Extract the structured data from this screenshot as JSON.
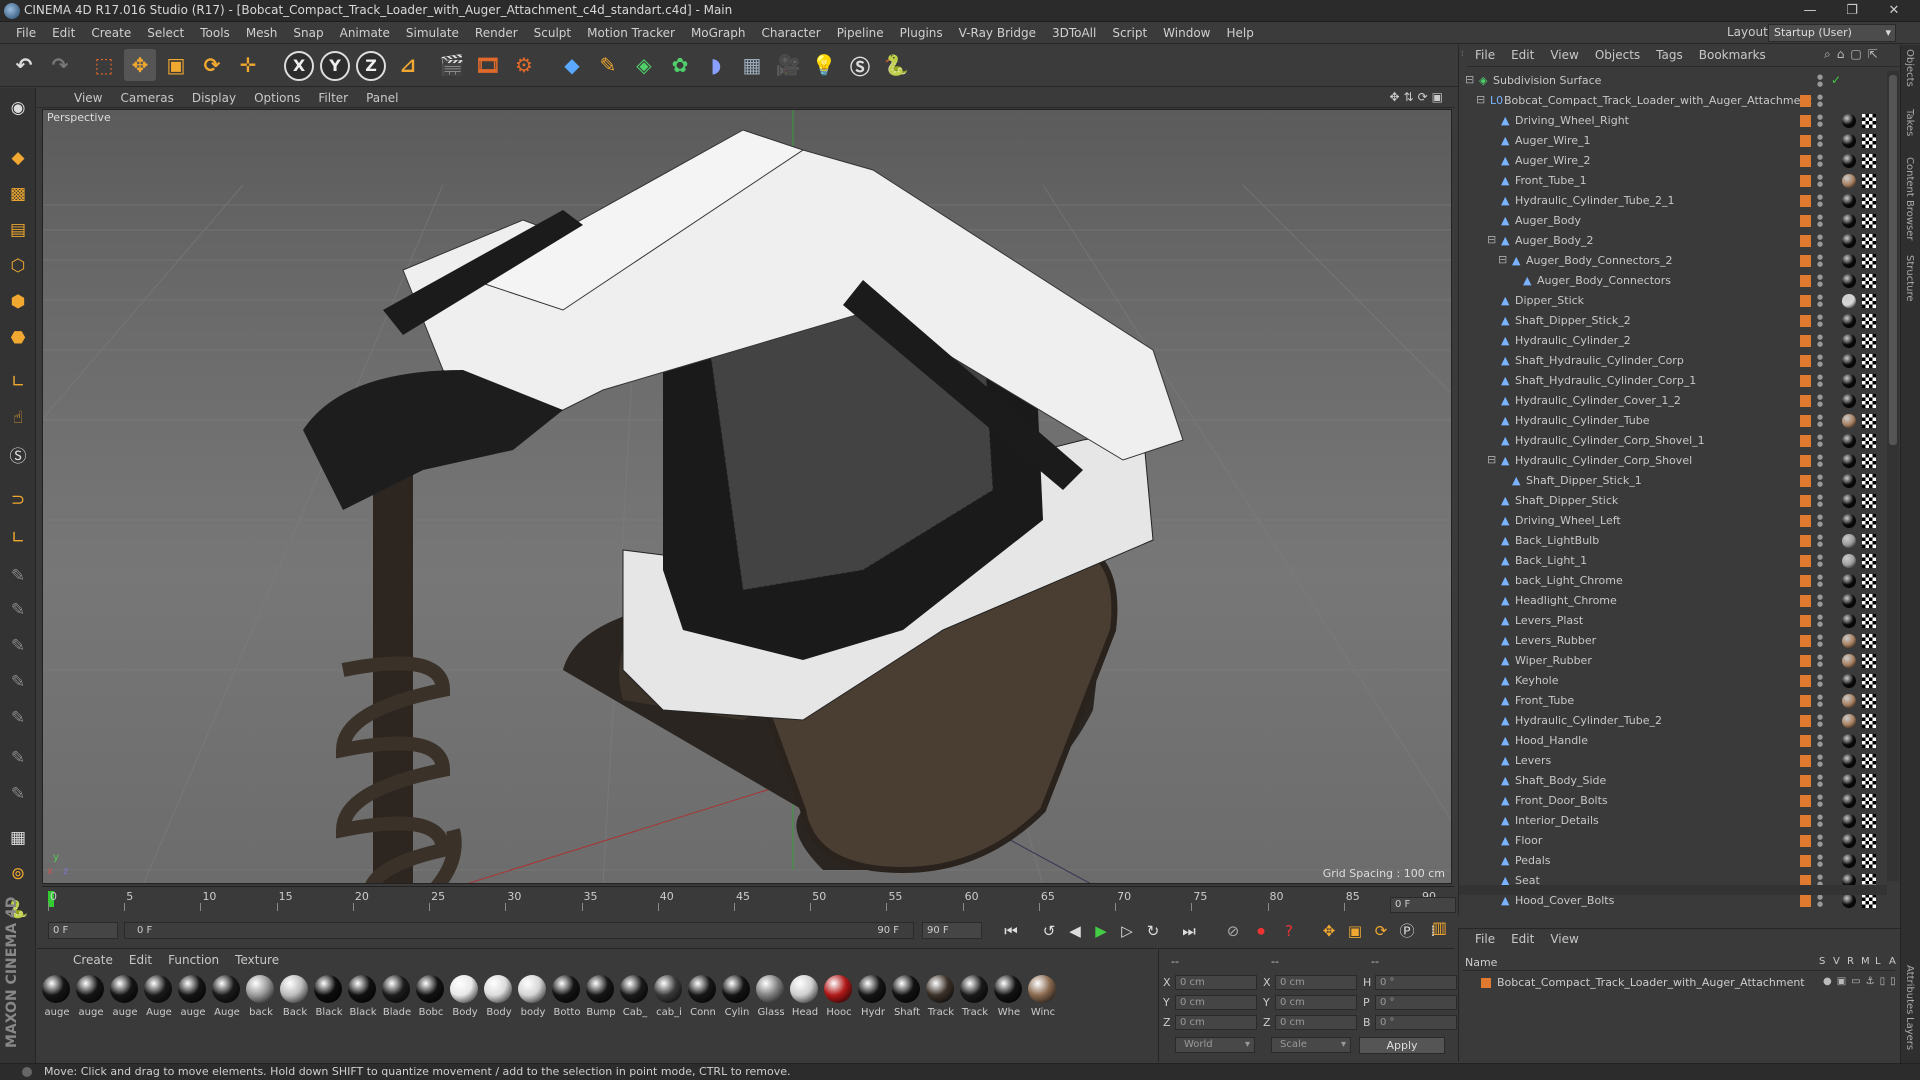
{
  "window": {
    "title": "CINEMA 4D R17.016 Studio (R17) - [Bobcat_Compact_Track_Loader_with_Auger_Attachment_c4d_standart.c4d] - Main",
    "controls": [
      "—",
      "❐",
      "✕"
    ]
  },
  "menu": [
    "File",
    "Edit",
    "Create",
    "Select",
    "Tools",
    "Mesh",
    "Snap",
    "Animate",
    "Simulate",
    "Render",
    "Sculpt",
    "Motion Tracker",
    "MoGraph",
    "Character",
    "Pipeline",
    "Plugins",
    "V-Ray Bridge",
    "3DToAll",
    "Script",
    "Window",
    "Help"
  ],
  "layout": {
    "label": "Layout:",
    "value": "Startup (User)"
  },
  "toolbar": {
    "axis": [
      "X",
      "Y",
      "Z"
    ]
  },
  "viewport": {
    "menu": [
      "View",
      "Cameras",
      "Display",
      "Options",
      "Filter",
      "Panel"
    ],
    "label": "Perspective",
    "grid_spacing": "Grid Spacing : 100 cm"
  },
  "timeline": {
    "ticks": [
      "0",
      "5",
      "10",
      "15",
      "20",
      "25",
      "30",
      "35",
      "40",
      "45",
      "50",
      "55",
      "60",
      "65",
      "70",
      "75",
      "80",
      "85",
      "90"
    ],
    "end_field": "0 F",
    "start_field": "0 F",
    "range_start": "0 F",
    "range_end": "90 F",
    "max_field": "90 F"
  },
  "materials": {
    "menu": [
      "Create",
      "Edit",
      "Function",
      "Texture"
    ],
    "items": [
      {
        "name": "auge",
        "color": "#151515"
      },
      {
        "name": "auge",
        "color": "#151515"
      },
      {
        "name": "auge",
        "color": "#151515"
      },
      {
        "name": "Auge",
        "color": "#1a1a1a"
      },
      {
        "name": "auge",
        "color": "#151515"
      },
      {
        "name": "Auge",
        "color": "#1a1a1a"
      },
      {
        "name": "back",
        "color": "#9a9a9a"
      },
      {
        "name": "Back",
        "color": "#bcbcbc"
      },
      {
        "name": "Black",
        "color": "#0d0d0d"
      },
      {
        "name": "Black",
        "color": "#111"
      },
      {
        "name": "Blade",
        "color": "#1c1c1c"
      },
      {
        "name": "Bobc",
        "color": "#121212"
      },
      {
        "name": "Body",
        "color": "#e8e8e8"
      },
      {
        "name": "Body",
        "color": "#dcdcdc"
      },
      {
        "name": "body",
        "color": "#d5d5d5"
      },
      {
        "name": "Botto",
        "color": "#141414"
      },
      {
        "name": "Bump",
        "color": "#161616"
      },
      {
        "name": "Cab_",
        "color": "#1a1a1a"
      },
      {
        "name": "cab_i",
        "color": "#3a3a3a"
      },
      {
        "name": "Conn",
        "color": "#171717"
      },
      {
        "name": "Cylin",
        "color": "#131313"
      },
      {
        "name": "Glass",
        "color": "#808080"
      },
      {
        "name": "Head",
        "color": "#cfcfcf"
      },
      {
        "name": "Hooc",
        "color": "#b01818"
      },
      {
        "name": "Hydr",
        "color": "#151515"
      },
      {
        "name": "Shaft",
        "color": "#121212"
      },
      {
        "name": "Track",
        "color": "#3b3129"
      },
      {
        "name": "Track",
        "color": "#1a1a1a"
      },
      {
        "name": "Whe",
        "color": "#121212"
      },
      {
        "name": "Winc",
        "color": "#8a6a50"
      }
    ]
  },
  "coords": {
    "rows": [
      {
        "a": "X",
        "av": "0 cm",
        "b": "X",
        "bv": "0 cm",
        "c": "H",
        "cv": "0 °"
      },
      {
        "a": "Y",
        "av": "0 cm",
        "b": "Y",
        "bv": "0 cm",
        "c": "P",
        "cv": "0 °"
      },
      {
        "a": "Z",
        "av": "0 cm",
        "b": "Z",
        "bv": "0 cm",
        "c": "B",
        "cv": "0 °"
      }
    ],
    "header_a": "--",
    "header_b": "--",
    "header_c": "--",
    "world": "World",
    "scale": "Scale",
    "apply": "Apply"
  },
  "status": "Move: Click and drag to move elements. Hold down SHIFT to quantize movement / add to the selection in point mode, CTRL to remove.",
  "objects": {
    "menu": [
      "File",
      "Edit",
      "View",
      "Objects",
      "Tags",
      "Bookmarks"
    ],
    "rows": [
      {
        "name": "Subdivision Surface",
        "indent": 0,
        "expander": "⊟",
        "icon": "◈",
        "icon_color": "#4fd06a",
        "tag": "none"
      },
      {
        "name": "Bobcat_Compact_Track_Loader_with_Auger_Attachment",
        "indent": 1,
        "expander": "⊟",
        "icon": "L0",
        "icon_color": "#7ab2ff",
        "tag": "none"
      },
      {
        "name": "Driving_Wheel_Right",
        "indent": 2,
        "expander": "",
        "icon": "▲",
        "icon_color": "#7ab2ff",
        "tag": "#0a0a0a"
      },
      {
        "name": "Auger_Wire_1",
        "indent": 2,
        "expander": "",
        "icon": "▲",
        "icon_color": "#7ab2ff",
        "tag": "#0a0a0a"
      },
      {
        "name": "Auger_Wire_2",
        "indent": 2,
        "expander": "",
        "icon": "▲",
        "icon_color": "#7ab2ff",
        "tag": "#0a0a0a"
      },
      {
        "name": "Front_Tube_1",
        "indent": 2,
        "expander": "",
        "icon": "▲",
        "icon_color": "#7ab2ff",
        "tag": "#a88060"
      },
      {
        "name": "Hydraulic_Cylinder_Tube_2_1",
        "indent": 2,
        "expander": "",
        "icon": "▲",
        "icon_color": "#7ab2ff",
        "tag": "#0a0a0a"
      },
      {
        "name": "Auger_Body",
        "indent": 2,
        "expander": "",
        "icon": "▲",
        "icon_color": "#7ab2ff",
        "tag": "#0a0a0a"
      },
      {
        "name": "Auger_Body_2",
        "indent": 2,
        "expander": "⊟",
        "icon": "▲",
        "icon_color": "#7ab2ff",
        "tag": "#0a0a0a"
      },
      {
        "name": "Auger_Body_Connectors_2",
        "indent": 3,
        "expander": "⊟",
        "icon": "▲",
        "icon_color": "#7ab2ff",
        "tag": "#0a0a0a"
      },
      {
        "name": "Auger_Body_Connectors",
        "indent": 4,
        "expander": "",
        "icon": "▲",
        "icon_color": "#7ab2ff",
        "tag": "#0a0a0a"
      },
      {
        "name": "Dipper_Stick",
        "indent": 2,
        "expander": "",
        "icon": "▲",
        "icon_color": "#7ab2ff",
        "tag": "#d8d8d8"
      },
      {
        "name": "Shaft_Dipper_Stick_2",
        "indent": 2,
        "expander": "",
        "icon": "▲",
        "icon_color": "#7ab2ff",
        "tag": "#0a0a0a"
      },
      {
        "name": "Hydraulic_Cylinder_2",
        "indent": 2,
        "expander": "",
        "icon": "▲",
        "icon_color": "#7ab2ff",
        "tag": "#0a0a0a"
      },
      {
        "name": "Shaft_Hydraulic_Cylinder_Corp",
        "indent": 2,
        "expander": "",
        "icon": "▲",
        "icon_color": "#7ab2ff",
        "tag": "#0a0a0a"
      },
      {
        "name": "Shaft_Hydraulic_Cylinder_Corp_1",
        "indent": 2,
        "expander": "",
        "icon": "▲",
        "icon_color": "#7ab2ff",
        "tag": "#0a0a0a"
      },
      {
        "name": "Hydraulic_Cylinder_Cover_1_2",
        "indent": 2,
        "expander": "",
        "icon": "▲",
        "icon_color": "#7ab2ff",
        "tag": "#0a0a0a"
      },
      {
        "name": "Hydraulic_Cylinder_Tube",
        "indent": 2,
        "expander": "",
        "icon": "▲",
        "icon_color": "#7ab2ff",
        "tag": "#a88060"
      },
      {
        "name": "Hydraulic_Cylinder_Corp_Shovel_1",
        "indent": 2,
        "expander": "",
        "icon": "▲",
        "icon_color": "#7ab2ff",
        "tag": "#0a0a0a"
      },
      {
        "name": "Hydraulic_Cylinder_Corp_Shovel",
        "indent": 2,
        "expander": "⊟",
        "icon": "▲",
        "icon_color": "#7ab2ff",
        "tag": "#0a0a0a"
      },
      {
        "name": "Shaft_Dipper_Stick_1",
        "indent": 3,
        "expander": "",
        "icon": "▲",
        "icon_color": "#7ab2ff",
        "tag": "#0a0a0a"
      },
      {
        "name": "Shaft_Dipper_Stick",
        "indent": 2,
        "expander": "",
        "icon": "▲",
        "icon_color": "#7ab2ff",
        "tag": "#0a0a0a"
      },
      {
        "name": "Driving_Wheel_Left",
        "indent": 2,
        "expander": "",
        "icon": "▲",
        "icon_color": "#7ab2ff",
        "tag": "#0a0a0a"
      },
      {
        "name": "Back_LightBulb",
        "indent": 2,
        "expander": "",
        "icon": "▲",
        "icon_color": "#7ab2ff",
        "tag": "#9a9a9a"
      },
      {
        "name": "Back_Light_1",
        "indent": 2,
        "expander": "",
        "icon": "▲",
        "icon_color": "#7ab2ff",
        "tag": "#a0a0a0"
      },
      {
        "name": "back_Light_Chrome",
        "indent": 2,
        "expander": "",
        "icon": "▲",
        "icon_color": "#7ab2ff",
        "tag": "#0a0a0a"
      },
      {
        "name": "Headlight_Chrome",
        "indent": 2,
        "expander": "",
        "icon": "▲",
        "icon_color": "#7ab2ff",
        "tag": "#0a0a0a"
      },
      {
        "name": "Levers_Plast",
        "indent": 2,
        "expander": "",
        "icon": "▲",
        "icon_color": "#7ab2ff",
        "tag": "#0a0a0a"
      },
      {
        "name": "Levers_Rubber",
        "indent": 2,
        "expander": "",
        "icon": "▲",
        "icon_color": "#7ab2ff",
        "tag": "#a88060"
      },
      {
        "name": "Wiper_Rubber",
        "indent": 2,
        "expander": "",
        "icon": "▲",
        "icon_color": "#7ab2ff",
        "tag": "#a88060"
      },
      {
        "name": "Keyhole",
        "indent": 2,
        "expander": "",
        "icon": "▲",
        "icon_color": "#7ab2ff",
        "tag": "#0a0a0a"
      },
      {
        "name": "Front_Tube",
        "indent": 2,
        "expander": "",
        "icon": "▲",
        "icon_color": "#7ab2ff",
        "tag": "#a88060"
      },
      {
        "name": "Hydraulic_Cylinder_Tube_2",
        "indent": 2,
        "expander": "",
        "icon": "▲",
        "icon_color": "#7ab2ff",
        "tag": "#a88060"
      },
      {
        "name": "Hood_Handle",
        "indent": 2,
        "expander": "",
        "icon": "▲",
        "icon_color": "#7ab2ff",
        "tag": "#0a0a0a"
      },
      {
        "name": "Levers",
        "indent": 2,
        "expander": "",
        "icon": "▲",
        "icon_color": "#7ab2ff",
        "tag": "#0a0a0a"
      },
      {
        "name": "Shaft_Body_Side",
        "indent": 2,
        "expander": "",
        "icon": "▲",
        "icon_color": "#7ab2ff",
        "tag": "#0a0a0a"
      },
      {
        "name": "Front_Door_Bolts",
        "indent": 2,
        "expander": "",
        "icon": "▲",
        "icon_color": "#7ab2ff",
        "tag": "#0a0a0a"
      },
      {
        "name": "Interior_Details",
        "indent": 2,
        "expander": "",
        "icon": "▲",
        "icon_color": "#7ab2ff",
        "tag": "#0a0a0a"
      },
      {
        "name": "Floor",
        "indent": 2,
        "expander": "",
        "icon": "▲",
        "icon_color": "#7ab2ff",
        "tag": "#0a0a0a"
      },
      {
        "name": "Pedals",
        "indent": 2,
        "expander": "",
        "icon": "▲",
        "icon_color": "#7ab2ff",
        "tag": "#0a0a0a"
      },
      {
        "name": "Seat",
        "indent": 2,
        "expander": "",
        "icon": "▲",
        "icon_color": "#7ab2ff",
        "tag": "#0a0a0a"
      },
      {
        "name": "Hood_Cover_Bolts",
        "indent": 2,
        "expander": "",
        "icon": "▲",
        "icon_color": "#7ab2ff",
        "tag": "#0a0a0a"
      }
    ]
  },
  "layers": {
    "menu": [
      "File",
      "Edit",
      "View"
    ],
    "header": {
      "name": "Name",
      "cols": [
        "S",
        "V",
        "R",
        "M",
        "L",
        "A"
      ]
    },
    "row": "Bobcat_Compact_Track_Loader_with_Auger_Attachment"
  },
  "side_tabs": [
    "Objects",
    "Takes",
    "Content Browser",
    "Structure",
    "Attributes",
    "Layers"
  ],
  "colors": {
    "accent": "#e07a2e",
    "object_icon": "#7ab2ff"
  }
}
